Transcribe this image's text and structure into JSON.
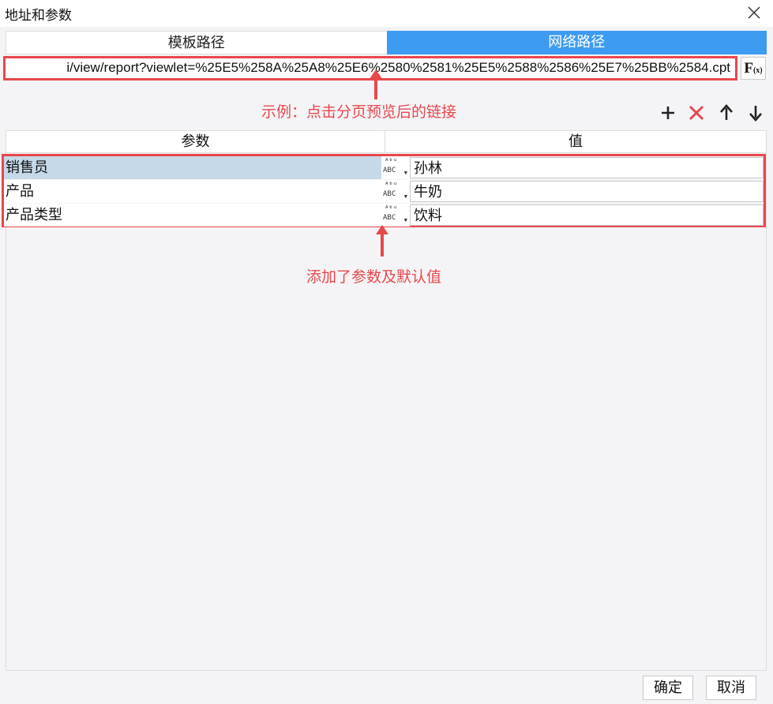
{
  "window": {
    "title": "地址和参数",
    "close_icon": "close-icon"
  },
  "tabs": [
    {
      "label": "模板路径",
      "active": false
    },
    {
      "label": "网络路径",
      "active": true
    }
  ],
  "url_field": {
    "value": "i/view/report?viewlet=%25E5%258A%25A8%25E6%2580%2581%25E5%2588%2586%25E7%25BB%2584.cpt"
  },
  "formula_button": {
    "label": "F",
    "sub": "(x)"
  },
  "annotations": {
    "url_note": "示例：点击分页预览后的链接",
    "params_note": "添加了参数及默认值"
  },
  "toolbar": {
    "icons": [
      "add-icon",
      "delete-icon",
      "move-up-icon",
      "move-down-icon"
    ]
  },
  "table": {
    "headers": [
      "参数",
      "值"
    ],
    "rows": [
      {
        "name": "销售员",
        "value": "孙林",
        "type_icon": "abc-type-icon",
        "selected": true
      },
      {
        "name": "产品",
        "value": "牛奶",
        "type_icon": "abc-type-icon",
        "selected": false
      },
      {
        "name": "产品类型",
        "value": "饮料",
        "type_icon": "abc-type-icon",
        "selected": false
      }
    ]
  },
  "footer": {
    "ok_label": "确定",
    "cancel_label": "取消"
  },
  "colors": {
    "accent": "#3d9bf2",
    "annotation": "#e8474c",
    "selected_row": "#c5d9e8"
  }
}
